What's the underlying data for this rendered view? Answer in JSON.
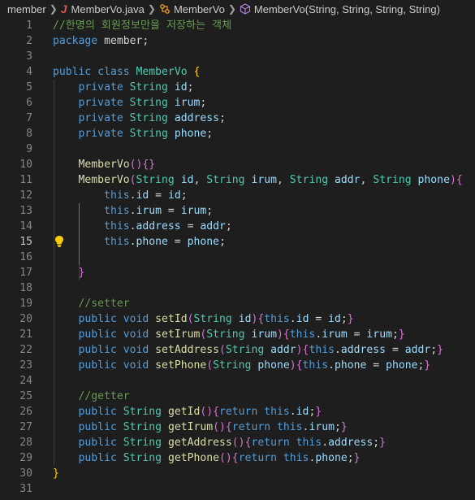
{
  "breadcrumb": {
    "items": [
      {
        "label": "member",
        "icon": ""
      },
      {
        "label": "MemberVo.java",
        "icon": "java-file-icon"
      },
      {
        "label": "MemberVo",
        "icon": "class-icon"
      },
      {
        "label": "MemberVo(String, String, String, String)",
        "icon": "method-icon"
      }
    ]
  },
  "editor": {
    "active_line": 15,
    "lines": [
      {
        "n": "1",
        "tokens": [
          {
            "t": "//한명의 회원정보만을 저장하는 객체",
            "c": "comment"
          }
        ]
      },
      {
        "n": "2",
        "tokens": [
          {
            "t": "package",
            "c": "kw"
          },
          {
            "t": " member;",
            "c": "punct"
          }
        ]
      },
      {
        "n": "3",
        "tokens": []
      },
      {
        "n": "4",
        "tokens": [
          {
            "t": "public",
            "c": "kw"
          },
          {
            "t": " ",
            "c": "punct"
          },
          {
            "t": "class",
            "c": "kw"
          },
          {
            "t": " ",
            "c": "punct"
          },
          {
            "t": "MemberVo",
            "c": "type"
          },
          {
            "t": " ",
            "c": "punct"
          },
          {
            "t": "{",
            "c": "b1"
          }
        ]
      },
      {
        "n": "5",
        "tokens": [
          {
            "t": "    private",
            "c": "kw"
          },
          {
            "t": " ",
            "c": "punct"
          },
          {
            "t": "String",
            "c": "type"
          },
          {
            "t": " ",
            "c": "punct"
          },
          {
            "t": "id",
            "c": "var"
          },
          {
            "t": ";",
            "c": "punct"
          }
        ]
      },
      {
        "n": "6",
        "tokens": [
          {
            "t": "    private",
            "c": "kw"
          },
          {
            "t": " ",
            "c": "punct"
          },
          {
            "t": "String",
            "c": "type"
          },
          {
            "t": " ",
            "c": "punct"
          },
          {
            "t": "irum",
            "c": "var"
          },
          {
            "t": ";",
            "c": "punct"
          }
        ]
      },
      {
        "n": "7",
        "tokens": [
          {
            "t": "    private",
            "c": "kw"
          },
          {
            "t": " ",
            "c": "punct"
          },
          {
            "t": "String",
            "c": "type"
          },
          {
            "t": " ",
            "c": "punct"
          },
          {
            "t": "address",
            "c": "var"
          },
          {
            "t": ";",
            "c": "punct"
          }
        ]
      },
      {
        "n": "8",
        "tokens": [
          {
            "t": "    private",
            "c": "kw"
          },
          {
            "t": " ",
            "c": "punct"
          },
          {
            "t": "String",
            "c": "type"
          },
          {
            "t": " ",
            "c": "punct"
          },
          {
            "t": "phone",
            "c": "var"
          },
          {
            "t": ";",
            "c": "punct"
          }
        ]
      },
      {
        "n": "9",
        "tokens": []
      },
      {
        "n": "10",
        "tokens": [
          {
            "t": "    MemberVo",
            "c": "fn"
          },
          {
            "t": "()",
            "c": "b2"
          },
          {
            "t": "{}",
            "c": "b2"
          }
        ]
      },
      {
        "n": "11",
        "tokens": [
          {
            "t": "    MemberVo",
            "c": "fn"
          },
          {
            "t": "(",
            "c": "b2"
          },
          {
            "t": "String",
            "c": "type"
          },
          {
            "t": " ",
            "c": "punct"
          },
          {
            "t": "id",
            "c": "var"
          },
          {
            "t": ", ",
            "c": "punct"
          },
          {
            "t": "String",
            "c": "type"
          },
          {
            "t": " ",
            "c": "punct"
          },
          {
            "t": "irum",
            "c": "var"
          },
          {
            "t": ", ",
            "c": "punct"
          },
          {
            "t": "String",
            "c": "type"
          },
          {
            "t": " ",
            "c": "punct"
          },
          {
            "t": "addr",
            "c": "var"
          },
          {
            "t": ", ",
            "c": "punct"
          },
          {
            "t": "String",
            "c": "type"
          },
          {
            "t": " ",
            "c": "punct"
          },
          {
            "t": "phone",
            "c": "var"
          },
          {
            "t": "){",
            "c": "b2"
          }
        ]
      },
      {
        "n": "12",
        "tokens": [
          {
            "t": "        this",
            "c": "kw"
          },
          {
            "t": ".",
            "c": "punct"
          },
          {
            "t": "id",
            "c": "var"
          },
          {
            "t": " = ",
            "c": "punct"
          },
          {
            "t": "id",
            "c": "var"
          },
          {
            "t": ";",
            "c": "punct"
          }
        ]
      },
      {
        "n": "13",
        "tokens": [
          {
            "t": "        this",
            "c": "kw"
          },
          {
            "t": ".",
            "c": "punct"
          },
          {
            "t": "irum",
            "c": "var"
          },
          {
            "t": " = ",
            "c": "punct"
          },
          {
            "t": "irum",
            "c": "var"
          },
          {
            "t": ";",
            "c": "punct"
          }
        ]
      },
      {
        "n": "14",
        "tokens": [
          {
            "t": "        this",
            "c": "kw"
          },
          {
            "t": ".",
            "c": "punct"
          },
          {
            "t": "address",
            "c": "var"
          },
          {
            "t": " = ",
            "c": "punct"
          },
          {
            "t": "addr",
            "c": "var"
          },
          {
            "t": ";",
            "c": "punct"
          }
        ]
      },
      {
        "n": "15",
        "tokens": [
          {
            "t": "        this",
            "c": "kw"
          },
          {
            "t": ".",
            "c": "punct"
          },
          {
            "t": "phone",
            "c": "var"
          },
          {
            "t": " = ",
            "c": "punct"
          },
          {
            "t": "phone",
            "c": "var"
          },
          {
            "t": ";",
            "c": "punct"
          }
        ]
      },
      {
        "n": "16",
        "tokens": []
      },
      {
        "n": "17",
        "tokens": [
          {
            "t": "    }",
            "c": "b2"
          }
        ]
      },
      {
        "n": "18",
        "tokens": []
      },
      {
        "n": "19",
        "tokens": [
          {
            "t": "    //setter",
            "c": "comment"
          }
        ]
      },
      {
        "n": "20",
        "tokens": [
          {
            "t": "    public",
            "c": "kw"
          },
          {
            "t": " ",
            "c": "punct"
          },
          {
            "t": "void",
            "c": "kw"
          },
          {
            "t": " ",
            "c": "punct"
          },
          {
            "t": "setId",
            "c": "fn"
          },
          {
            "t": "(",
            "c": "b2"
          },
          {
            "t": "String",
            "c": "type"
          },
          {
            "t": " ",
            "c": "punct"
          },
          {
            "t": "id",
            "c": "var"
          },
          {
            "t": "){",
            "c": "b2"
          },
          {
            "t": "this",
            "c": "kw"
          },
          {
            "t": ".",
            "c": "punct"
          },
          {
            "t": "id",
            "c": "var"
          },
          {
            "t": " = ",
            "c": "punct"
          },
          {
            "t": "id",
            "c": "var"
          },
          {
            "t": ";",
            "c": "punct"
          },
          {
            "t": "}",
            "c": "b2"
          }
        ]
      },
      {
        "n": "21",
        "tokens": [
          {
            "t": "    public",
            "c": "kw"
          },
          {
            "t": " ",
            "c": "punct"
          },
          {
            "t": "void",
            "c": "kw"
          },
          {
            "t": " ",
            "c": "punct"
          },
          {
            "t": "setIrum",
            "c": "fn"
          },
          {
            "t": "(",
            "c": "b2"
          },
          {
            "t": "String",
            "c": "type"
          },
          {
            "t": " ",
            "c": "punct"
          },
          {
            "t": "irum",
            "c": "var"
          },
          {
            "t": "){",
            "c": "b2"
          },
          {
            "t": "this",
            "c": "kw"
          },
          {
            "t": ".",
            "c": "punct"
          },
          {
            "t": "irum",
            "c": "var"
          },
          {
            "t": " = ",
            "c": "punct"
          },
          {
            "t": "irum",
            "c": "var"
          },
          {
            "t": ";",
            "c": "punct"
          },
          {
            "t": "}",
            "c": "b2"
          }
        ]
      },
      {
        "n": "22",
        "tokens": [
          {
            "t": "    public",
            "c": "kw"
          },
          {
            "t": " ",
            "c": "punct"
          },
          {
            "t": "void",
            "c": "kw"
          },
          {
            "t": " ",
            "c": "punct"
          },
          {
            "t": "setAddress",
            "c": "fn"
          },
          {
            "t": "(",
            "c": "b2"
          },
          {
            "t": "String",
            "c": "type"
          },
          {
            "t": " ",
            "c": "punct"
          },
          {
            "t": "addr",
            "c": "var"
          },
          {
            "t": "){",
            "c": "b2"
          },
          {
            "t": "this",
            "c": "kw"
          },
          {
            "t": ".",
            "c": "punct"
          },
          {
            "t": "address",
            "c": "var"
          },
          {
            "t": " = ",
            "c": "punct"
          },
          {
            "t": "addr",
            "c": "var"
          },
          {
            "t": ";",
            "c": "punct"
          },
          {
            "t": "}",
            "c": "b2"
          }
        ]
      },
      {
        "n": "23",
        "tokens": [
          {
            "t": "    public",
            "c": "kw"
          },
          {
            "t": " ",
            "c": "punct"
          },
          {
            "t": "void",
            "c": "kw"
          },
          {
            "t": " ",
            "c": "punct"
          },
          {
            "t": "setPhone",
            "c": "fn"
          },
          {
            "t": "(",
            "c": "b2"
          },
          {
            "t": "String",
            "c": "type"
          },
          {
            "t": " ",
            "c": "punct"
          },
          {
            "t": "phone",
            "c": "var"
          },
          {
            "t": "){",
            "c": "b2"
          },
          {
            "t": "this",
            "c": "kw"
          },
          {
            "t": ".",
            "c": "punct"
          },
          {
            "t": "phone",
            "c": "var"
          },
          {
            "t": " = ",
            "c": "punct"
          },
          {
            "t": "phone",
            "c": "var"
          },
          {
            "t": ";",
            "c": "punct"
          },
          {
            "t": "}",
            "c": "b2"
          }
        ]
      },
      {
        "n": "24",
        "tokens": []
      },
      {
        "n": "25",
        "tokens": [
          {
            "t": "    //getter",
            "c": "comment"
          }
        ]
      },
      {
        "n": "26",
        "tokens": [
          {
            "t": "    public",
            "c": "kw"
          },
          {
            "t": " ",
            "c": "punct"
          },
          {
            "t": "String",
            "c": "type"
          },
          {
            "t": " ",
            "c": "punct"
          },
          {
            "t": "getId",
            "c": "fn"
          },
          {
            "t": "()",
            "c": "b2"
          },
          {
            "t": "{",
            "c": "b2"
          },
          {
            "t": "return",
            "c": "kw"
          },
          {
            "t": " ",
            "c": "punct"
          },
          {
            "t": "this",
            "c": "kw"
          },
          {
            "t": ".",
            "c": "punct"
          },
          {
            "t": "id",
            "c": "var"
          },
          {
            "t": ";",
            "c": "punct"
          },
          {
            "t": "}",
            "c": "b2"
          }
        ]
      },
      {
        "n": "27",
        "tokens": [
          {
            "t": "    public",
            "c": "kw"
          },
          {
            "t": " ",
            "c": "punct"
          },
          {
            "t": "String",
            "c": "type"
          },
          {
            "t": " ",
            "c": "punct"
          },
          {
            "t": "getIrum",
            "c": "fn"
          },
          {
            "t": "()",
            "c": "b2"
          },
          {
            "t": "{",
            "c": "b2"
          },
          {
            "t": "return",
            "c": "kw"
          },
          {
            "t": " ",
            "c": "punct"
          },
          {
            "t": "this",
            "c": "kw"
          },
          {
            "t": ".",
            "c": "punct"
          },
          {
            "t": "irum",
            "c": "var"
          },
          {
            "t": ";",
            "c": "punct"
          },
          {
            "t": "}",
            "c": "b2"
          }
        ]
      },
      {
        "n": "28",
        "tokens": [
          {
            "t": "    public",
            "c": "kw"
          },
          {
            "t": " ",
            "c": "punct"
          },
          {
            "t": "String",
            "c": "type"
          },
          {
            "t": " ",
            "c": "punct"
          },
          {
            "t": "getAddress",
            "c": "fn"
          },
          {
            "t": "()",
            "c": "b2"
          },
          {
            "t": "{",
            "c": "b2"
          },
          {
            "t": "return",
            "c": "kw"
          },
          {
            "t": " ",
            "c": "punct"
          },
          {
            "t": "this",
            "c": "kw"
          },
          {
            "t": ".",
            "c": "punct"
          },
          {
            "t": "address",
            "c": "var"
          },
          {
            "t": ";",
            "c": "punct"
          },
          {
            "t": "}",
            "c": "b2"
          }
        ]
      },
      {
        "n": "29",
        "tokens": [
          {
            "t": "    public",
            "c": "kw"
          },
          {
            "t": " ",
            "c": "punct"
          },
          {
            "t": "String",
            "c": "type"
          },
          {
            "t": " ",
            "c": "punct"
          },
          {
            "t": "getPhone",
            "c": "fn"
          },
          {
            "t": "()",
            "c": "b2"
          },
          {
            "t": "{",
            "c": "b2"
          },
          {
            "t": "return",
            "c": "kw"
          },
          {
            "t": " ",
            "c": "punct"
          },
          {
            "t": "this",
            "c": "kw"
          },
          {
            "t": ".",
            "c": "punct"
          },
          {
            "t": "phone",
            "c": "var"
          },
          {
            "t": ";",
            "c": "punct"
          },
          {
            "t": "}",
            "c": "b2"
          }
        ]
      },
      {
        "n": "30",
        "tokens": [
          {
            "t": "}",
            "c": "b1"
          }
        ]
      },
      {
        "n": "31",
        "tokens": []
      }
    ]
  },
  "icons": {
    "lightbulb_line": 15,
    "lightbulb": "lightbulb-icon"
  },
  "colors": {
    "background": "#1e1e1e",
    "keyword": "#569cd6",
    "type": "#4ec9b0",
    "function": "#dcdcaa",
    "variable": "#9cdcfe",
    "comment": "#6a9955",
    "bracket1": "#ffd700",
    "bracket2": "#da70d6"
  }
}
